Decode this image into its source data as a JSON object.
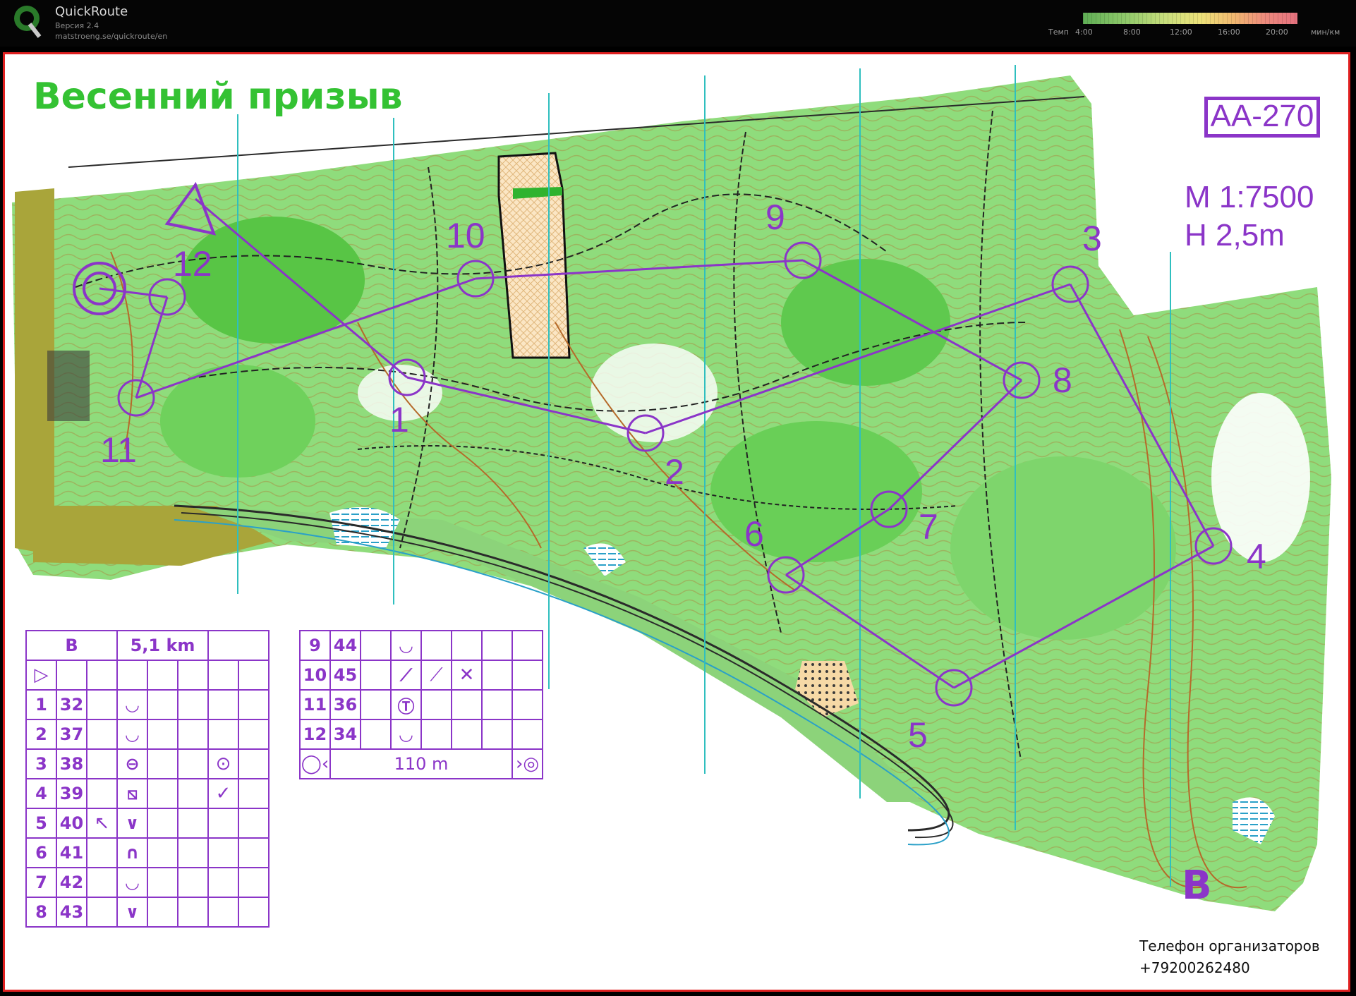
{
  "app": {
    "name": "QuickRoute",
    "version": "Версия 2.4",
    "url": "matstroeng.se/quickroute/en",
    "pace_legend": {
      "label": "Темп",
      "ticks": [
        "4:00",
        "8:00",
        "12:00",
        "16:00",
        "20:00"
      ],
      "unit": "мин/км",
      "colors": [
        "#5fae55",
        "#c7de7c",
        "#ede27a",
        "#f1b970",
        "#e5717e"
      ]
    }
  },
  "map": {
    "title": "Весенний призыв",
    "code": "AA-270",
    "scale": "M 1:7500",
    "contour": "H 2,5m",
    "course_class": "B",
    "phone_label": "Телефон организаторов",
    "phone_number": "+79200262480",
    "course_color": "#8b35c8",
    "controls": [
      {
        "label": "1"
      },
      {
        "label": "2"
      },
      {
        "label": "3"
      },
      {
        "label": "4"
      },
      {
        "label": "5"
      },
      {
        "label": "6"
      },
      {
        "label": "7"
      },
      {
        "label": "8"
      },
      {
        "label": "9"
      },
      {
        "label": "10"
      },
      {
        "label": "11"
      },
      {
        "label": "12"
      }
    ]
  },
  "description_sheet": {
    "class": "B",
    "length": "5,1 km",
    "finish_distance": "110 m",
    "rows": [
      {
        "num": "1",
        "code": "32",
        "symbol": "◡"
      },
      {
        "num": "2",
        "code": "37",
        "symbol": "◡"
      },
      {
        "num": "3",
        "code": "38",
        "symbol": "⊖"
      },
      {
        "num": "4",
        "code": "39",
        "symbol": "⧅"
      },
      {
        "num": "5",
        "code": "40",
        "symbol": "∨"
      },
      {
        "num": "6",
        "code": "41",
        "symbol": "∩"
      },
      {
        "num": "7",
        "code": "42",
        "symbol": "◡"
      },
      {
        "num": "8",
        "code": "43",
        "symbol": "∨"
      },
      {
        "num": "9",
        "code": "44",
        "symbol": "◡"
      },
      {
        "num": "10",
        "code": "45",
        "symbol": "⟋"
      },
      {
        "num": "11",
        "code": "36",
        "symbol": "Ⓣ"
      },
      {
        "num": "12",
        "code": "34",
        "symbol": "◡"
      }
    ]
  }
}
